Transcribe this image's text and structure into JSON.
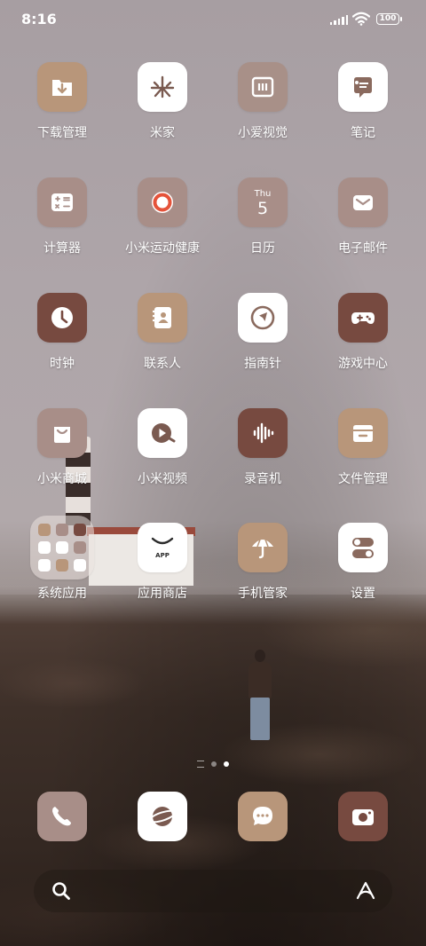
{
  "status_bar": {
    "time": "8:16",
    "battery": "100"
  },
  "apps": [
    {
      "label": "下载管理",
      "name": "download-manager",
      "icon": "download-icon",
      "bg": "#b8967a"
    },
    {
      "label": "米家",
      "name": "mijia",
      "icon": "mi-home-icon",
      "bg": "#ffffff"
    },
    {
      "label": "小爱视觉",
      "name": "xiaoai-vision",
      "icon": "scan-icon",
      "bg": "#a89088"
    },
    {
      "label": "笔记",
      "name": "notes",
      "icon": "notes-icon",
      "bg": "#ffffff"
    },
    {
      "label": "计算器",
      "name": "calculator",
      "icon": "calculator-icon",
      "bg": "#a88e88"
    },
    {
      "label": "小米运动健康",
      "name": "mi-fitness",
      "icon": "fitness-ring-icon",
      "bg": "#a88e88"
    },
    {
      "label": "日历",
      "name": "calendar",
      "icon": "calendar-icon",
      "bg": "#a88e88",
      "day": "Thu",
      "date": "5"
    },
    {
      "label": "电子邮件",
      "name": "email",
      "icon": "mail-icon",
      "bg": "#a88e88"
    },
    {
      "label": "时钟",
      "name": "clock",
      "icon": "clock-icon",
      "bg": "#774a40"
    },
    {
      "label": "联系人",
      "name": "contacts",
      "icon": "contacts-book-icon",
      "bg": "#b8967a"
    },
    {
      "label": "指南针",
      "name": "compass",
      "icon": "compass-icon",
      "bg": "#ffffff"
    },
    {
      "label": "游戏中心",
      "name": "game-center",
      "icon": "gamepad-icon",
      "bg": "#774a40"
    },
    {
      "label": "小米商城",
      "name": "mi-store",
      "icon": "shopping-bag-icon",
      "bg": "#a88e88"
    },
    {
      "label": "小米视频",
      "name": "mi-video",
      "icon": "play-icon",
      "bg": "#ffffff"
    },
    {
      "label": "录音机",
      "name": "recorder",
      "icon": "waveform-icon",
      "bg": "#774a40"
    },
    {
      "label": "文件管理",
      "name": "file-manager",
      "icon": "folder-icon",
      "bg": "#b8967a"
    },
    {
      "label": "系统应用",
      "name": "system-apps-folder",
      "icon": "folder-grid-icon",
      "bg": "folder"
    },
    {
      "label": "应用商店",
      "name": "app-store",
      "icon": "app-store-icon",
      "bg": "#ffffff",
      "text": "APP"
    },
    {
      "label": "手机管家",
      "name": "security",
      "icon": "umbrella-icon",
      "bg": "#b8967a"
    },
    {
      "label": "设置",
      "name": "settings",
      "icon": "toggle-icon",
      "bg": "#ffffff"
    }
  ],
  "dock": [
    {
      "name": "phone",
      "icon": "phone-icon",
      "bg": "#a88e88"
    },
    {
      "name": "browser",
      "icon": "planet-icon",
      "bg": "#ffffff"
    },
    {
      "name": "messages",
      "icon": "message-icon",
      "bg": "#b8967a"
    },
    {
      "name": "camera",
      "icon": "camera-icon",
      "bg": "#774a40"
    }
  ],
  "colors": {
    "brown_dark": "#774a40",
    "tan": "#b8967a",
    "mauve": "#a88e88",
    "white": "#ffffff"
  }
}
